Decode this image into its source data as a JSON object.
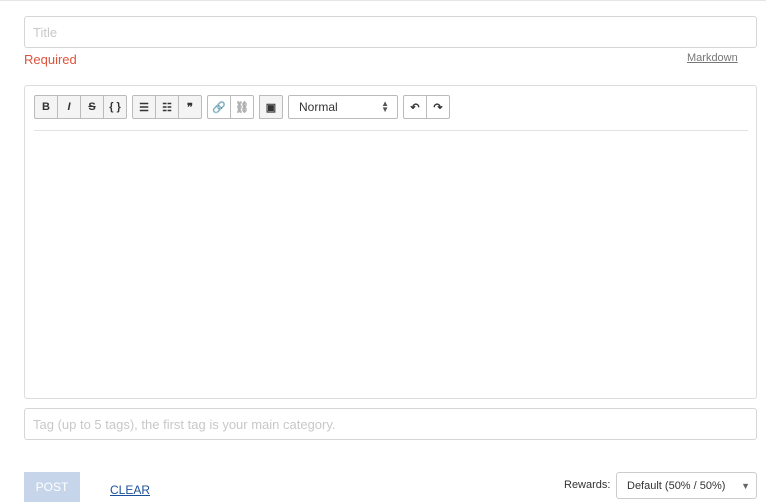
{
  "title_input": {
    "placeholder": "Title",
    "value": ""
  },
  "validation": {
    "title_error": "Required"
  },
  "markdown_link": "Markdown",
  "toolbar": {
    "groups": [
      [
        {
          "name": "bold",
          "glyph": "B"
        },
        {
          "name": "italic",
          "glyph": "I"
        },
        {
          "name": "strikethrough",
          "glyph": "S"
        },
        {
          "name": "code",
          "glyph": "{ }"
        }
      ],
      [
        {
          "name": "bullet-list",
          "glyph": "☰"
        },
        {
          "name": "ordered-list",
          "glyph": "☷"
        },
        {
          "name": "blockquote",
          "glyph": "❞"
        }
      ],
      [
        {
          "name": "link",
          "glyph": "🔗"
        },
        {
          "name": "unlink",
          "glyph": "⛓"
        }
      ],
      [
        {
          "name": "image",
          "glyph": "▣"
        }
      ]
    ],
    "format_select": "Normal",
    "history": [
      {
        "name": "undo",
        "glyph": "↶"
      },
      {
        "name": "redo",
        "glyph": "↷"
      }
    ]
  },
  "tags_input": {
    "placeholder": "Tag (up to 5 tags), the first tag is your main category.",
    "value": ""
  },
  "actions": {
    "post": "POST",
    "clear": "CLEAR"
  },
  "rewards": {
    "label": "Rewards:",
    "selected": "Default (50% / 50%)"
  }
}
